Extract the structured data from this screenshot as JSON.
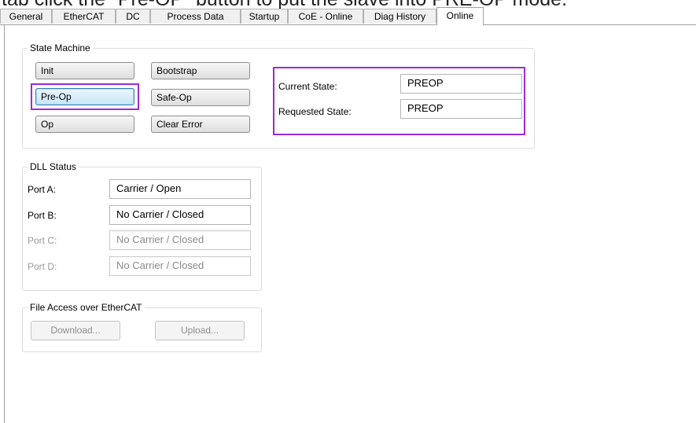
{
  "caption": "tab click the \"Pre-OP\" button to put the slave into PRE-OP mode.",
  "tabs": [
    {
      "label": "General"
    },
    {
      "label": "EtherCAT"
    },
    {
      "label": "DC"
    },
    {
      "label": "Process Data"
    },
    {
      "label": "Startup"
    },
    {
      "label": "CoE - Online"
    },
    {
      "label": "Diag History"
    },
    {
      "label": "Online",
      "active": true
    }
  ],
  "state_machine": {
    "title": "State Machine",
    "buttons": {
      "init": "Init",
      "bootstrap": "Bootstrap",
      "pre_op": "Pre-Op",
      "safe_op": "Safe-Op",
      "op": "Op",
      "clear_error": "Clear Error"
    },
    "current_state_label": "Current State:",
    "current_state_value": "PREOP",
    "requested_state_label": "Requested State:",
    "requested_state_value": "PREOP"
  },
  "dll_status": {
    "title": "DLL Status",
    "ports": [
      {
        "label": "Port A:",
        "value": "Carrier / Open",
        "enabled": true
      },
      {
        "label": "Port B:",
        "value": "No Carrier / Closed",
        "enabled": true
      },
      {
        "label": "Port C:",
        "value": "No Carrier / Closed",
        "enabled": false
      },
      {
        "label": "Port D:",
        "value": "No Carrier / Closed",
        "enabled": false
      }
    ]
  },
  "file_access": {
    "title": "File Access over EtherCAT",
    "download_label": "Download...",
    "upload_label": "Upload..."
  },
  "colors": {
    "highlight": "#a02ad0",
    "focus_border": "#3c7fb1"
  }
}
